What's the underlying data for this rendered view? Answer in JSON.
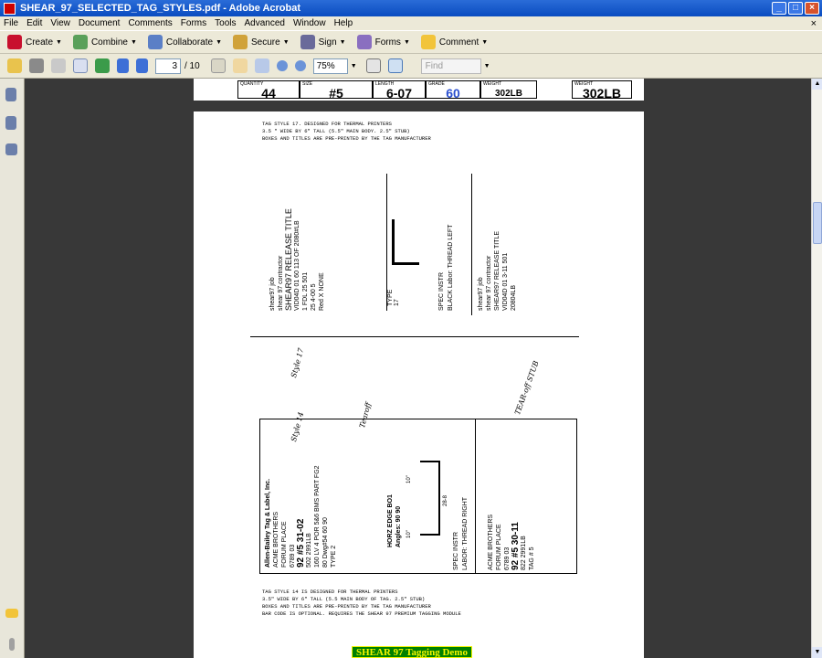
{
  "window": {
    "title": "SHEAR_97_SELECTED_TAG_STYLES.pdf - Adobe Acrobat"
  },
  "menu": [
    "File",
    "Edit",
    "View",
    "Document",
    "Comments",
    "Forms",
    "Tools",
    "Advanced",
    "Window",
    "Help"
  ],
  "toolbar": {
    "create": "Create",
    "combine": "Combine",
    "collaborate": "Collaborate",
    "secure": "Secure",
    "sign": "Sign",
    "forms": "Forms",
    "comment": "Comment"
  },
  "nav": {
    "page_current": "3",
    "page_total": "/ 10",
    "zoom": "75%",
    "find_placeholder": "Find"
  },
  "tag_header": {
    "quantity_label": "QUANTITY",
    "quantity": "44",
    "size_label": "SIZE",
    "size": "#5",
    "length_label": "LENGTH",
    "length": "6-07",
    "grade_label": "GRADE",
    "grade": "60",
    "weight_label": "WEIGHT",
    "weight": "302LB",
    "weight2_label": "WEIGHT",
    "weight2": "302LB"
  },
  "notes_top": [
    "TAG STYLE 17. DESIGNED FOR THERMAL PRINTERS",
    "3.5 \" WIDE BY 6\" TALL (5.5\" MAIN BODY. 2.5\" STUB)",
    "BOXES AND TITLES ARE PRE-PRINTED BY THE TAG MANUFACTURER"
  ],
  "notes_bottom": [
    "TAG STYLE 14 IS DESIGNED FOR THERMAL PRINTERS",
    "3.5\" WIDE BY 6\" TALL (5.5 MAIN BODY OF TAG. 2.5\" STUB)",
    "BOXES AND TITLES ARE PRE-PRINTED BY THE TAG MANUFACTURER",
    "BAR CODE IS OPTIONAL. REQUIRES THE SHEAR 97 PREMIUM TAGGING MODULE"
  ],
  "tag17": {
    "lines": [
      "shear97 job",
      "shear 97 contractor",
      "SHEAR97 RELEASE TITLE",
      "VID04D  01  60  113 OF 2080#LB",
      "1 FDL  25  501",
      "25  4-00  5",
      "Red  X  NONE"
    ],
    "stub": [
      "SPEC INSTR",
      "BLACK   Labor: THREAD LEFT"
    ],
    "stub_lines": [
      "shear97 job",
      "shear 97 contractor",
      "SHEAR97 RELEASE TITLE",
      "VID04D 01 3-11 501",
      "20804LB"
    ],
    "type": "TYPE 17",
    "dims": [
      "1-8",
      "2-4"
    ],
    "hand": [
      "Style 17",
      "Tearoff"
    ]
  },
  "tag14": {
    "company": "Allen-Bailey Tag & Label, Inc.",
    "lines": [
      "ACME BROTHERS",
      "FORUM PLACE",
      "6789  03",
      "92  #5  31-02",
      "502  2991LB",
      "160 LV 4 POR 5&6 BMS PART FG2",
      "80  Dwg#54  60 90"
    ],
    "type": "TYPE 2",
    "shape": [
      "HORZ EDGE BO1",
      "Angles: 90 90",
      "10\"",
      "28-8",
      "10\""
    ],
    "stub": [
      "SPEC INSTR",
      "LABOR: THREAD RIGHT"
    ],
    "stub_lines": [
      "ACME BROTHERS",
      "FORUM PLACE",
      "6789  03",
      "92  #5  30-11",
      "822  2991LB",
      "TAG # 5"
    ],
    "hand": [
      "Style 14",
      "TEAR-off STUB"
    ]
  },
  "banner": "SHEAR 97 Tagging Demo"
}
